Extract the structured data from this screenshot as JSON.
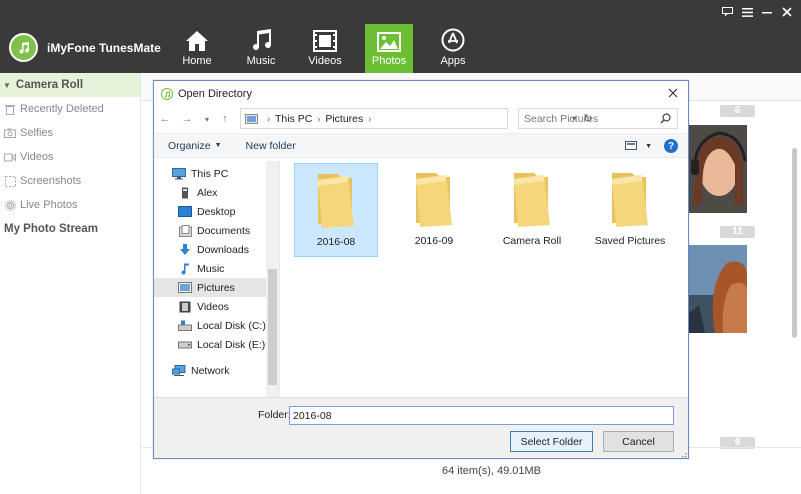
{
  "app": {
    "brand_name": "iMyFone TunesMate",
    "nav": [
      {
        "label": "Home",
        "icon": "home-icon"
      },
      {
        "label": "Music",
        "icon": "music-note-icon"
      },
      {
        "label": "Videos",
        "icon": "film-icon"
      },
      {
        "label": "Photos",
        "icon": "photo-icon",
        "active": true
      },
      {
        "label": "Apps",
        "icon": "app-store-icon"
      }
    ],
    "accent_color": "#6cbe35",
    "topbar_color": "#3a3a3a"
  },
  "sidebar": {
    "section_label": "Camera Roll",
    "items": [
      {
        "label": "Recently Deleted",
        "icon": "trash-icon"
      },
      {
        "label": "Selfies",
        "icon": "camera-icon"
      },
      {
        "label": "Videos",
        "icon": "video-icon"
      },
      {
        "label": "Screenshots",
        "icon": "screenshot-icon"
      },
      {
        "label": "Live Photos",
        "icon": "live-photo-icon"
      }
    ],
    "stream_label": "My Photo Stream"
  },
  "main": {
    "badges": [
      "6",
      "11",
      "9"
    ],
    "status": "64 item(s), 49.01MB"
  },
  "dialog": {
    "title": "Open Directory",
    "breadcrumb": [
      "This PC",
      "Pictures"
    ],
    "search_placeholder": "Search Pictures",
    "organize_label": "Organize",
    "new_folder_label": "New folder",
    "tree": [
      {
        "label": "This PC",
        "icon": "computer-icon"
      },
      {
        "label": "Alex",
        "icon": "user-folder-icon"
      },
      {
        "label": "Desktop",
        "icon": "desktop-icon"
      },
      {
        "label": "Documents",
        "icon": "documents-icon"
      },
      {
        "label": "Downloads",
        "icon": "downloads-icon"
      },
      {
        "label": "Music",
        "icon": "music-icon"
      },
      {
        "label": "Pictures",
        "icon": "pictures-icon",
        "selected": true
      },
      {
        "label": "Videos",
        "icon": "videos-icon"
      },
      {
        "label": "Local Disk (C:)",
        "icon": "drive-c-icon"
      },
      {
        "label": "Local Disk (E:)",
        "icon": "drive-e-icon"
      },
      {
        "label": "Network",
        "icon": "network-icon"
      }
    ],
    "folders": [
      {
        "name": "2016-08",
        "selected": true
      },
      {
        "name": "2016-09"
      },
      {
        "name": "Camera Roll"
      },
      {
        "name": "Saved Pictures"
      }
    ],
    "folder_field_label": "Folder:",
    "folder_value": "2016-08",
    "select_button": "Select Folder",
    "cancel_button": "Cancel"
  }
}
